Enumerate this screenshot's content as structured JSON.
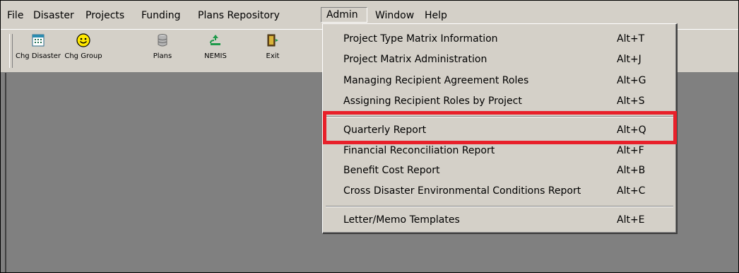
{
  "menubar": {
    "items": [
      "File",
      "Disaster",
      "Projects",
      "Funding",
      "Plans Repository",
      "Admin",
      "Window",
      "Help"
    ]
  },
  "toolbar": {
    "buttons": [
      {
        "label": "Chg Disaster",
        "icon": "calendar-icon"
      },
      {
        "label": "Chg Group",
        "icon": "smiley-icon"
      },
      {
        "label": "Plans",
        "icon": "database-icon"
      },
      {
        "label": "NEMIS",
        "icon": "recycle-icon"
      },
      {
        "label": "Exit",
        "icon": "exit-door-icon"
      }
    ]
  },
  "admin_menu": {
    "items": [
      {
        "label": "Project Type Matrix Information",
        "shortcut": "Alt+T"
      },
      {
        "label": "Project Matrix Administration",
        "shortcut": "Alt+J"
      },
      {
        "label": "Managing Recipient Agreement Roles",
        "shortcut": "Alt+G"
      },
      {
        "label": "Assigning Recipient Roles by Project",
        "shortcut": "Alt+S"
      },
      {
        "label": "Quarterly Report",
        "shortcut": "Alt+Q"
      },
      {
        "label": "Financial Reconciliation Report",
        "shortcut": "Alt+F"
      },
      {
        "label": "Benefit Cost Report",
        "shortcut": "Alt+B"
      },
      {
        "label": "Cross Disaster Environmental Conditions Report",
        "shortcut": "Alt+C"
      },
      {
        "label": "Letter/Memo Templates",
        "shortcut": "Alt+E"
      }
    ]
  },
  "colors": {
    "highlight": "#e8202a",
    "chrome": "#d4d0c8",
    "workspace": "#808080"
  }
}
